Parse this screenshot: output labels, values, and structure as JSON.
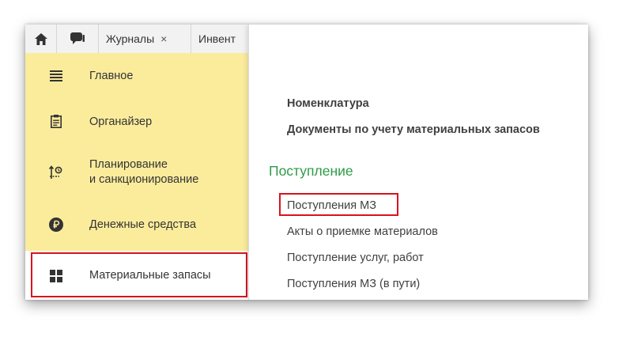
{
  "tabs": [
    {
      "label": "Журналы",
      "close": "×"
    },
    {
      "label": "Инвент",
      "close": ""
    }
  ],
  "sidebar": {
    "items": [
      {
        "label": "Главное",
        "icon": "menu-lines-icon"
      },
      {
        "label": "Органайзер",
        "icon": "clipboard-icon"
      },
      {
        "label": "Планирование\nи санкционирование",
        "icon": "planning-icon"
      },
      {
        "label": "Денежные средства",
        "icon": "ruble-coin-icon"
      },
      {
        "label": "Материальные запасы",
        "icon": "grid-icon"
      }
    ]
  },
  "panel": {
    "top_links": [
      "Номенклатура",
      "Документы по учету материальных запасов"
    ],
    "section_title": "Поступление",
    "section_links": [
      "Поступления МЗ",
      "Акты о приемке материалов",
      "Поступление услуг, работ",
      "Поступления МЗ (в пути)"
    ]
  },
  "colors": {
    "sidebar_bg": "#fbec9c",
    "highlight": "#d9131d",
    "section_green": "#2e9b47"
  }
}
